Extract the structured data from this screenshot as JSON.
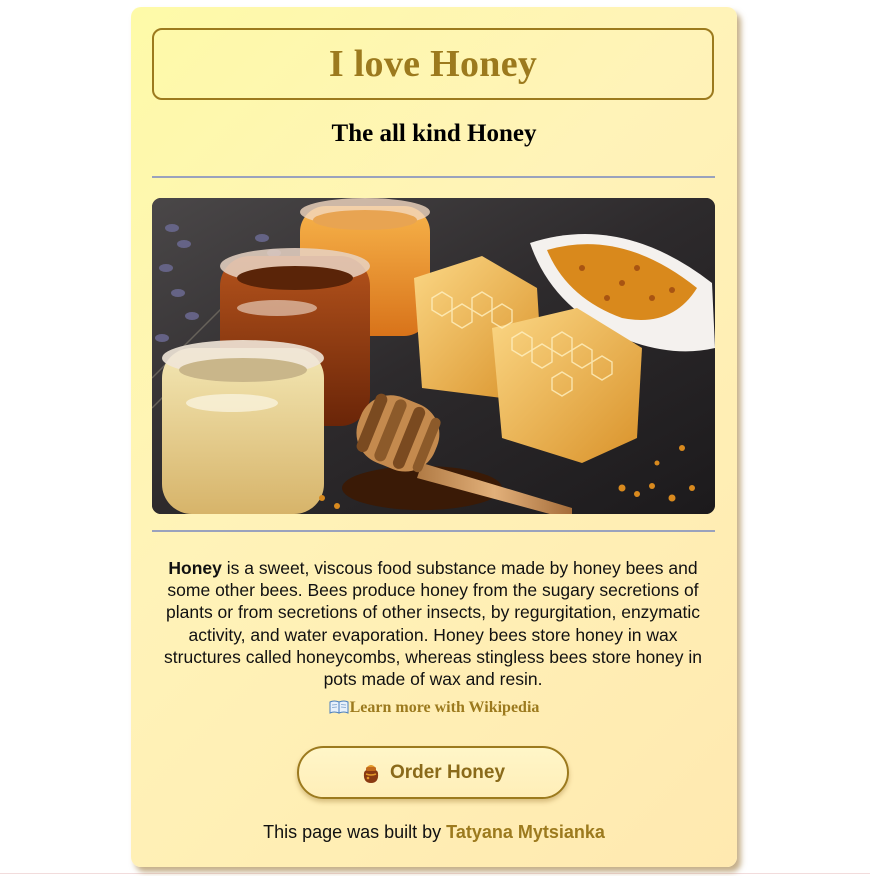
{
  "page": {
    "title": "I love Honey",
    "subtitle": "The all kind Honey"
  },
  "image": {
    "alt": "Jars of honey with honeycomb, wooden honey dipper and bee pollen"
  },
  "description": {
    "lead": "Honey",
    "body": " is a sweet, viscous food substance made by honey bees and some other bees. Bees produce honey from the sugary secretions of plants or from secretions of other insects, by regurgitation, enzymatic activity, and water evaporation. Honey bees store honey in wax structures called honeycombs, whereas stingless bees store honey in pots made of wax and resin."
  },
  "links": {
    "wiki_label": "Learn more with Wikipedia",
    "wiki_icon": "open-book-icon"
  },
  "order": {
    "label": "Order Honey",
    "icon": "honey-pot-icon"
  },
  "footer": {
    "prefix": "This page was built by ",
    "author": "Tatyana Mytsianka"
  },
  "colors": {
    "accent": "#9c7a1e",
    "card_bg": "#fff3b8",
    "rule": "#9aa2bd"
  }
}
